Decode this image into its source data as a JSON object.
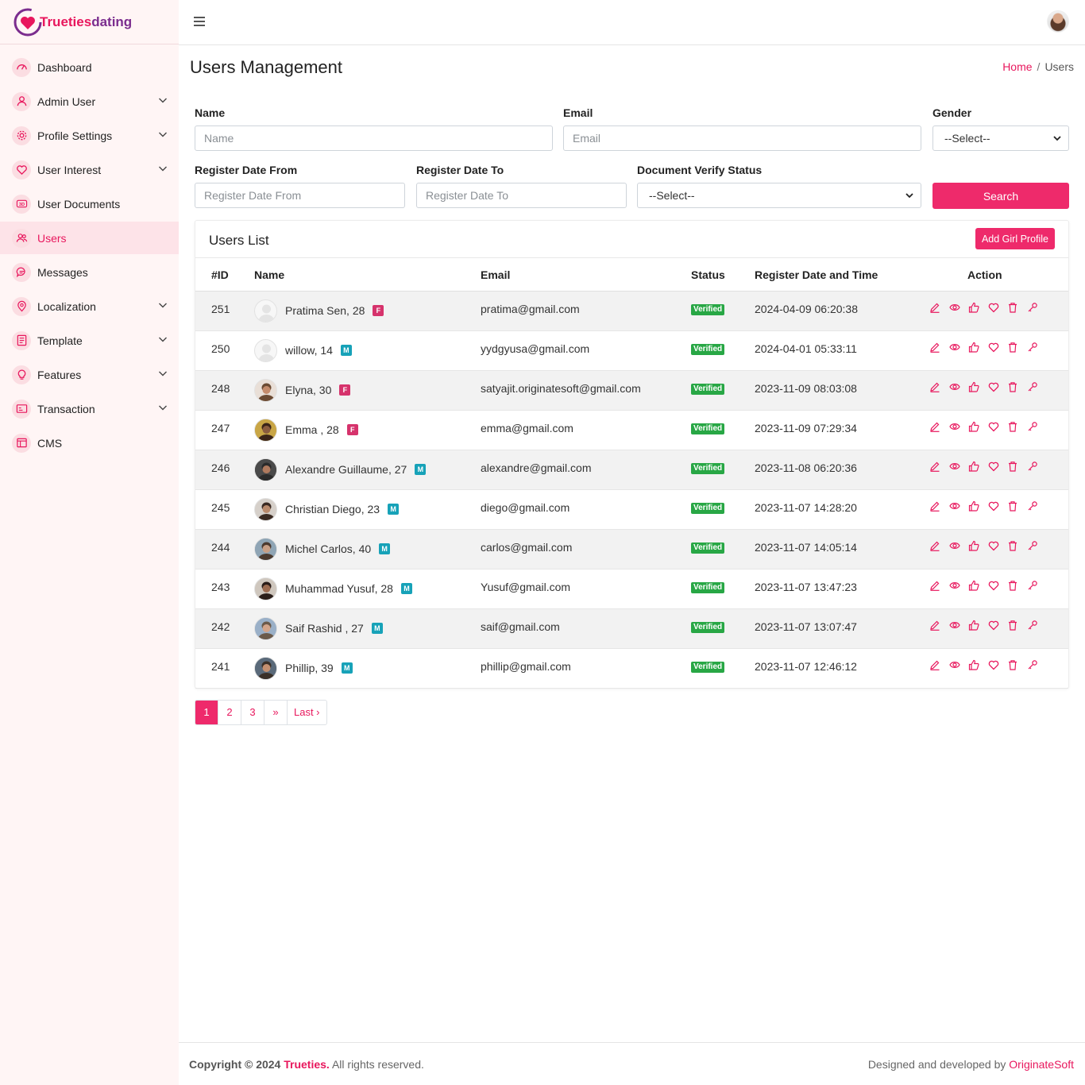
{
  "brand": {
    "name_part1": "Trueties",
    "name_part2": "dating",
    "accent": "#e8175d"
  },
  "sidebar": {
    "items": [
      {
        "label": "Dashboard",
        "icon": "dashboard-icon",
        "chevron": false
      },
      {
        "label": "Admin User",
        "icon": "user-icon",
        "chevron": true
      },
      {
        "label": "Profile Settings",
        "icon": "gear-icon",
        "chevron": true
      },
      {
        "label": "User Interest",
        "icon": "heart-icon",
        "chevron": true
      },
      {
        "label": "User Documents",
        "icon": "3d-icon",
        "chevron": false
      },
      {
        "label": "Users",
        "icon": "users-icon",
        "chevron": false,
        "active": true
      },
      {
        "label": "Messages",
        "icon": "chat-icon",
        "chevron": false
      },
      {
        "label": "Localization",
        "icon": "location-pin-icon",
        "chevron": true
      },
      {
        "label": "Template",
        "icon": "template-icon",
        "chevron": true
      },
      {
        "label": "Features",
        "icon": "bulb-icon",
        "chevron": true
      },
      {
        "label": "Transaction",
        "icon": "transaction-icon",
        "chevron": true
      },
      {
        "label": "CMS",
        "icon": "cms-icon",
        "chevron": false
      }
    ]
  },
  "header": {
    "title": "Users Management",
    "breadcrumb_home": "Home",
    "breadcrumb_sep": "/",
    "breadcrumb_current": "Users"
  },
  "filters": {
    "name_label": "Name",
    "name_placeholder": "Name",
    "email_label": "Email",
    "email_placeholder": "Email",
    "gender_label": "Gender",
    "gender_value": "--Select--",
    "from_label": "Register Date From",
    "from_placeholder": "Register Date From",
    "to_label": "Register Date To",
    "to_placeholder": "Register Date To",
    "doc_label": "Document Verify Status",
    "doc_value": "--Select--",
    "search_label": "Search"
  },
  "users_list": {
    "title": "Users List",
    "add_label": "Add Girl Profile",
    "columns": [
      "#ID",
      "Name",
      "Email",
      "Status",
      "Register Date and Time",
      "Action"
    ],
    "rows": [
      {
        "id": "251",
        "name": "Pratima Sen, 28",
        "gender": "F",
        "email": "pratima@gmail.com",
        "status": "Verified",
        "date": "2024-04-09 06:20:38",
        "avatar": "placeholder"
      },
      {
        "id": "250",
        "name": "willow, 14",
        "gender": "M",
        "email": "yydgyusa@gmail.com",
        "status": "Verified",
        "date": "2024-04-01 05:33:11",
        "avatar": "placeholder"
      },
      {
        "id": "248",
        "name": "Elyna, 30",
        "gender": "F",
        "email": "satyajit.originatesoft@gmail.com",
        "status": "Verified",
        "date": "2023-11-09 08:03:08",
        "avatar": "photo"
      },
      {
        "id": "247",
        "name": "Emma , 28",
        "gender": "F",
        "email": "emma@gmail.com",
        "status": "Verified",
        "date": "2023-11-09 07:29:34",
        "avatar": "photo"
      },
      {
        "id": "246",
        "name": "Alexandre Guillaume, 27",
        "gender": "M",
        "email": "alexandre@gmail.com",
        "status": "Verified",
        "date": "2023-11-08 06:20:36",
        "avatar": "photo"
      },
      {
        "id": "245",
        "name": "Christian Diego, 23",
        "gender": "M",
        "email": "diego@gmail.com",
        "status": "Verified",
        "date": "2023-11-07 14:28:20",
        "avatar": "photo"
      },
      {
        "id": "244",
        "name": "Michel Carlos, 40",
        "gender": "M",
        "email": "carlos@gmail.com",
        "status": "Verified",
        "date": "2023-11-07 14:05:14",
        "avatar": "photo"
      },
      {
        "id": "243",
        "name": "Muhammad Yusuf, 28",
        "gender": "M",
        "email": "Yusuf@gmail.com",
        "status": "Verified",
        "date": "2023-11-07 13:47:23",
        "avatar": "photo"
      },
      {
        "id": "242",
        "name": "Saif Rashid , 27",
        "gender": "M",
        "email": "saif@gmail.com",
        "status": "Verified",
        "date": "2023-11-07 13:07:47",
        "avatar": "photo"
      },
      {
        "id": "241",
        "name": "Phillip, 39",
        "gender": "M",
        "email": "phillip@gmail.com",
        "status": "Verified",
        "date": "2023-11-07 12:46:12",
        "avatar": "photo"
      }
    ],
    "actions": [
      "edit-icon",
      "view-eye-icon",
      "like-thumb-icon",
      "favorite-heart-icon",
      "delete-trash-icon",
      "key-icon"
    ]
  },
  "pagination": {
    "pages": [
      "1",
      "2",
      "3",
      "»",
      "Last ›"
    ],
    "current": "1"
  },
  "footer": {
    "copyright_prefix": "Copyright © 2024",
    "copyright_brand": "Trueties.",
    "copyright_suffix": "All rights reserved.",
    "designed_prefix": "Designed and developed by",
    "designed_brand": "OriginateSoft"
  },
  "colors": {
    "accent": "#ee2a6b",
    "verified": "#28a745",
    "male_badge": "#17a2b8",
    "female_badge": "#d6336c",
    "sidebar_bg": "#fff5f5"
  }
}
